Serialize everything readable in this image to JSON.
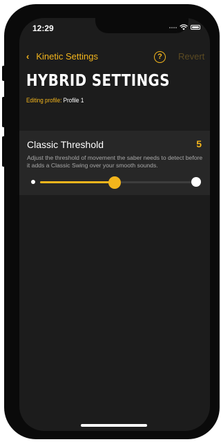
{
  "status_bar": {
    "time": "12:29",
    "icons": [
      "cellular-dots-icon",
      "wifi-icon",
      "battery-icon"
    ]
  },
  "nav": {
    "back_label": "Kinetic Settings",
    "back_icon": "chevron-left-icon",
    "help_icon": "question-circle-icon",
    "help_glyph": "?",
    "revert_label": "Revert"
  },
  "page": {
    "title": "HYBRID SETTINGS",
    "profile_label": "Editing profile:",
    "profile_name": "Profile 1"
  },
  "setting": {
    "name": "Classic Threshold",
    "value": "5",
    "description": "Adjust the threshold of movement the saber needs to detect before it adds a Classic Swing over your smooth sounds.",
    "slider_fraction": 0.48
  },
  "colors": {
    "accent": "#f3b51c",
    "background": "#1c1c1c",
    "card": "#272727",
    "revert_disabled": "#5b4a22"
  }
}
